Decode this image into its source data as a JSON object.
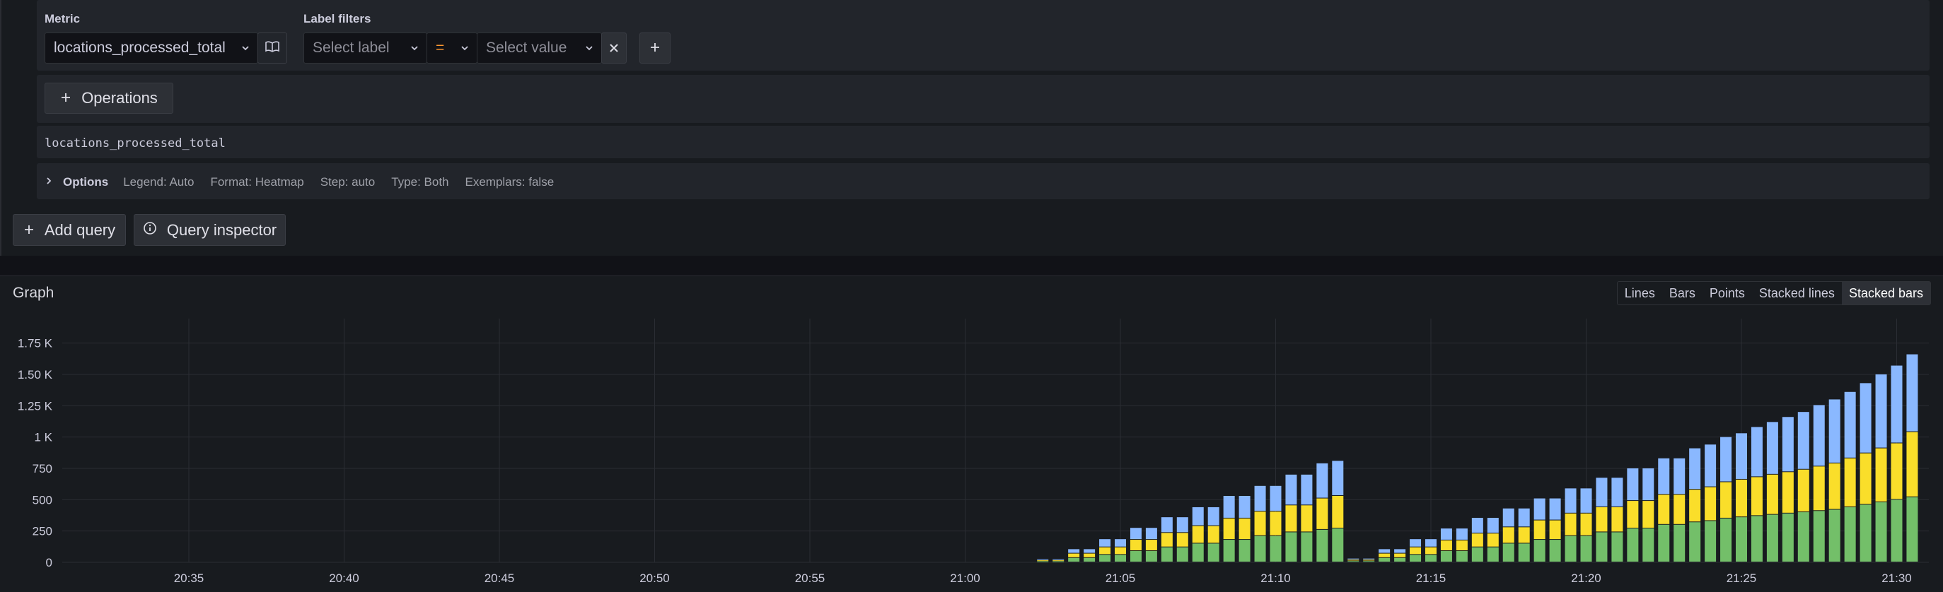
{
  "query_editor": {
    "metric_label": "Metric",
    "metric_value": "locations_processed_total",
    "label_filters_label": "Label filters",
    "label_placeholder": "Select label",
    "operator": "=",
    "value_placeholder": "Select value",
    "operations_label": "Operations",
    "raw_query": "locations_processed_total",
    "options": {
      "title": "Options",
      "legend": "Legend: Auto",
      "format": "Format: Heatmap",
      "step": "Step: auto",
      "type": "Type: Both",
      "exemplars": "Exemplars: false"
    },
    "add_query_label": "Add query",
    "query_inspector_label": "Query inspector"
  },
  "graph": {
    "title": "Graph",
    "view_modes": [
      "Lines",
      "Bars",
      "Points",
      "Stacked lines",
      "Stacked bars"
    ],
    "active_view_mode": "Stacked bars"
  },
  "colors": {
    "green": "#73bf69",
    "yellow": "#fade2a",
    "blue": "#8ab8ff",
    "accent": "#ff9830"
  },
  "chart_data": {
    "type": "bar",
    "stacked": true,
    "x_ticks": [
      "20:35",
      "20:40",
      "20:45",
      "20:50",
      "20:55",
      "21:00",
      "21:05",
      "21:10",
      "21:15",
      "21:20",
      "21:25",
      "21:30"
    ],
    "y_ticks": [
      "0",
      "250",
      "500",
      "750",
      "1 K",
      "1.25 K",
      "1.50 K",
      "1.75 K"
    ],
    "ylim": [
      0,
      1900
    ],
    "x": [
      "21:02:30",
      "21:03:00",
      "21:03:30",
      "21:04:00",
      "21:04:30",
      "21:05:00",
      "21:05:30",
      "21:06:00",
      "21:06:30",
      "21:07:00",
      "21:07:30",
      "21:08:00",
      "21:08:30",
      "21:09:00",
      "21:09:30",
      "21:10:00",
      "21:10:30",
      "21:11:00",
      "21:11:30",
      "21:12:00",
      "21:12:30",
      "21:13:00",
      "21:13:30",
      "21:14:00",
      "21:14:30",
      "21:15:00",
      "21:15:30",
      "21:16:00",
      "21:16:30",
      "21:17:00",
      "21:17:30",
      "21:18:00",
      "21:18:30",
      "21:19:00",
      "21:19:30",
      "21:20:00",
      "21:20:30",
      "21:21:00",
      "21:21:30",
      "21:22:00",
      "21:22:30",
      "21:23:00",
      "21:23:30",
      "21:24:00",
      "21:24:30",
      "21:25:00",
      "21:25:30",
      "21:26:00",
      "21:26:30",
      "21:27:00",
      "21:27:30",
      "21:28:00",
      "21:28:30",
      "21:29:00",
      "21:29:30",
      "21:30:00",
      "21:30:30"
    ],
    "series": [
      {
        "color": "green",
        "values": [
          8,
          8,
          35,
          35,
          60,
          60,
          90,
          90,
          120,
          120,
          150,
          150,
          180,
          180,
          210,
          210,
          240,
          240,
          260,
          270,
          10,
          10,
          35,
          35,
          60,
          60,
          90,
          90,
          120,
          120,
          150,
          150,
          180,
          180,
          210,
          210,
          240,
          240,
          270,
          270,
          300,
          300,
          320,
          330,
          350,
          360,
          370,
          380,
          390,
          400,
          410,
          420,
          440,
          460,
          480,
          500,
          520
        ]
      },
      {
        "color": "yellow",
        "values": [
          8,
          8,
          35,
          35,
          60,
          60,
          90,
          90,
          115,
          115,
          140,
          140,
          170,
          170,
          195,
          195,
          215,
          215,
          250,
          260,
          10,
          10,
          35,
          35,
          60,
          60,
          85,
          85,
          110,
          110,
          130,
          130,
          155,
          155,
          180,
          180,
          200,
          200,
          220,
          220,
          240,
          240,
          260,
          270,
          290,
          300,
          310,
          320,
          330,
          340,
          355,
          370,
          390,
          410,
          430,
          450,
          520
        ]
      },
      {
        "color": "blue",
        "values": [
          9,
          9,
          35,
          35,
          65,
          65,
          95,
          95,
          125,
          125,
          150,
          150,
          180,
          180,
          205,
          205,
          245,
          245,
          280,
          280,
          10,
          10,
          35,
          35,
          65,
          65,
          95,
          95,
          125,
          125,
          150,
          150,
          175,
          175,
          200,
          200,
          235,
          235,
          260,
          260,
          290,
          290,
          330,
          340,
          360,
          370,
          400,
          420,
          440,
          460,
          490,
          510,
          530,
          560,
          590,
          620,
          620
        ]
      }
    ]
  }
}
